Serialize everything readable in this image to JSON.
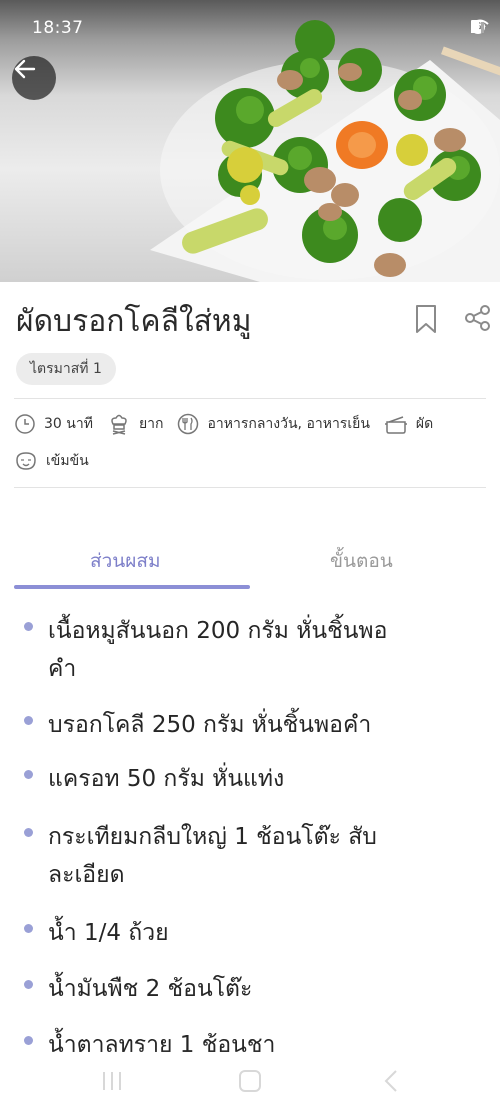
{
  "status_bar": {
    "time": "18:37"
  },
  "recipe": {
    "title": "ผัดบรอกโคลีใส่หมู",
    "chip": "ไตรมาสที่ 1",
    "meta": {
      "time": "30 นาที",
      "difficulty": "ยาก",
      "meal": "อาหารกลางวัน, อาหารเย็น",
      "method": "ผัด",
      "taste": "เข้มข้น"
    }
  },
  "tabs": {
    "ingredients": "ส่วนผสม",
    "steps": "ขั้นตอน"
  },
  "ingredients": [
    {
      "line1": "เนื้อหมูสันนอก 200 กรัม หั่นชิ้นพอ",
      "line2": "คำ"
    },
    {
      "line1": "บรอกโคลี 250 กรัม หั่นชิ้นพอคำ",
      "line2": ""
    },
    {
      "line1": "แครอท 50 กรัม หั่นแท่ง",
      "line2": ""
    },
    {
      "line1": "กระเทียมกลีบใหญ่ 1 ช้อนโต๊ะ สับ",
      "line2": "ละเอียด"
    },
    {
      "line1": "น้ำ 1/4 ถ้วย",
      "line2": ""
    },
    {
      "line1": "น้ำมันพืช 2 ช้อนโต๊ะ",
      "line2": ""
    },
    {
      "line1": "น้ำตาลทราย 1 ช้อนชา",
      "line2": ""
    }
  ],
  "colors": {
    "accent": "#7d7fc9",
    "bullet": "#9aa0d6"
  }
}
